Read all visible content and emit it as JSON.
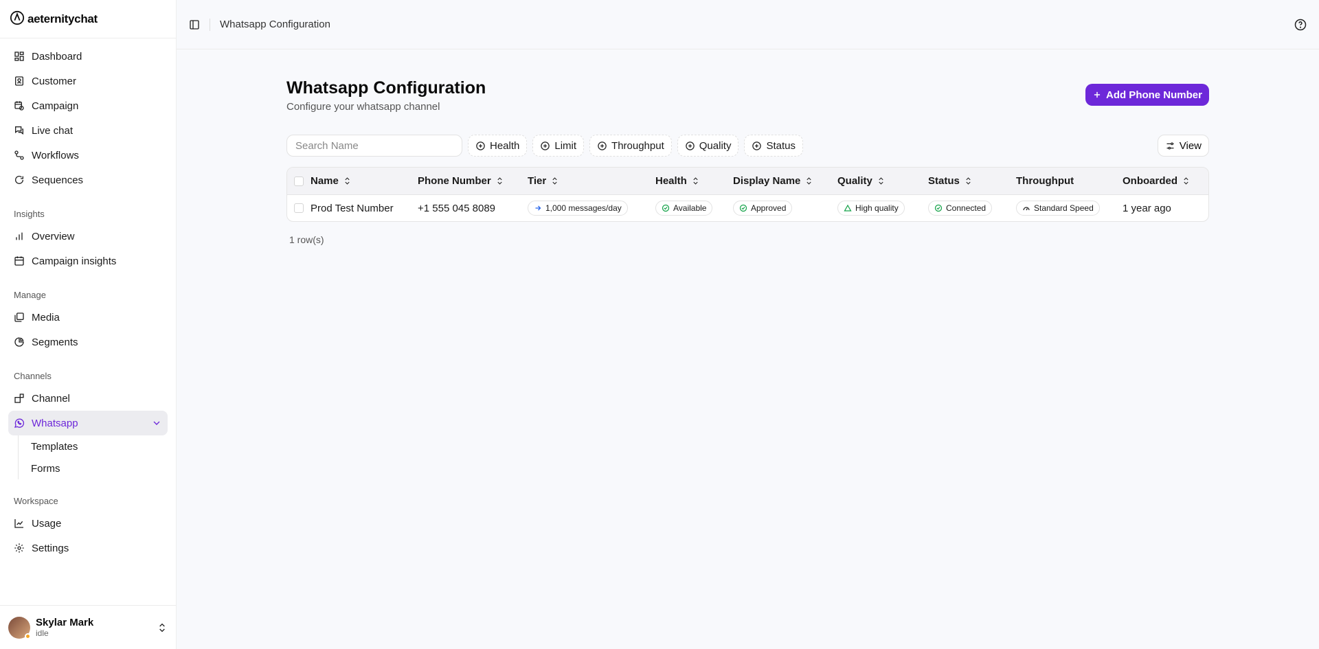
{
  "brand": {
    "name": "aeternitychat"
  },
  "sidebar": {
    "top_items": [
      {
        "label": "Dashboard",
        "icon": "dashboard-icon"
      },
      {
        "label": "Customer",
        "icon": "contact-icon"
      },
      {
        "label": "Campaign",
        "icon": "calendar-clock-icon"
      },
      {
        "label": "Live chat",
        "icon": "chat-icon"
      },
      {
        "label": "Workflows",
        "icon": "workflow-icon"
      },
      {
        "label": "Sequences",
        "icon": "refresh-icon"
      }
    ],
    "insights": {
      "label": "Insights",
      "items": [
        {
          "label": "Overview"
        },
        {
          "label": "Campaign insights"
        }
      ]
    },
    "manage": {
      "label": "Manage",
      "items": [
        {
          "label": "Media"
        },
        {
          "label": "Segments"
        }
      ]
    },
    "channels": {
      "label": "Channels",
      "channel": "Channel",
      "whatsapp": "Whatsapp",
      "sub_items": [
        "Templates",
        "Forms"
      ]
    },
    "workspace": {
      "label": "Workspace",
      "items": [
        {
          "label": "Usage"
        },
        {
          "label": "Settings"
        }
      ]
    }
  },
  "user": {
    "name": "Skylar Mark",
    "status": "idle"
  },
  "topbar": {
    "breadcrumb": "Whatsapp Configuration"
  },
  "page": {
    "title": "Whatsapp Configuration",
    "subtitle": "Configure your whatsapp channel",
    "add_button": "Add Phone Number"
  },
  "toolbar": {
    "search_placeholder": "Search Name",
    "filters": [
      "Health",
      "Limit",
      "Throughput",
      "Quality",
      "Status"
    ],
    "view_label": "View"
  },
  "table": {
    "columns": [
      "Name",
      "Phone Number",
      "Tier",
      "Health",
      "Display Name",
      "Quality",
      "Status",
      "Throughput",
      "Onboarded"
    ],
    "rows": [
      {
        "name": "Prod Test Number",
        "phone": "+1 555 045 8089",
        "tier": "1,000 messages/day",
        "health": "Available",
        "display_name": "Approved",
        "quality": "High quality",
        "status": "Connected",
        "throughput": "Standard Speed",
        "onboarded": "1 year ago"
      }
    ],
    "row_count": "1 row(s)"
  },
  "colors": {
    "accent": "#6d28d9",
    "success": "#16a34a",
    "tier_arrow": "#2563eb"
  }
}
